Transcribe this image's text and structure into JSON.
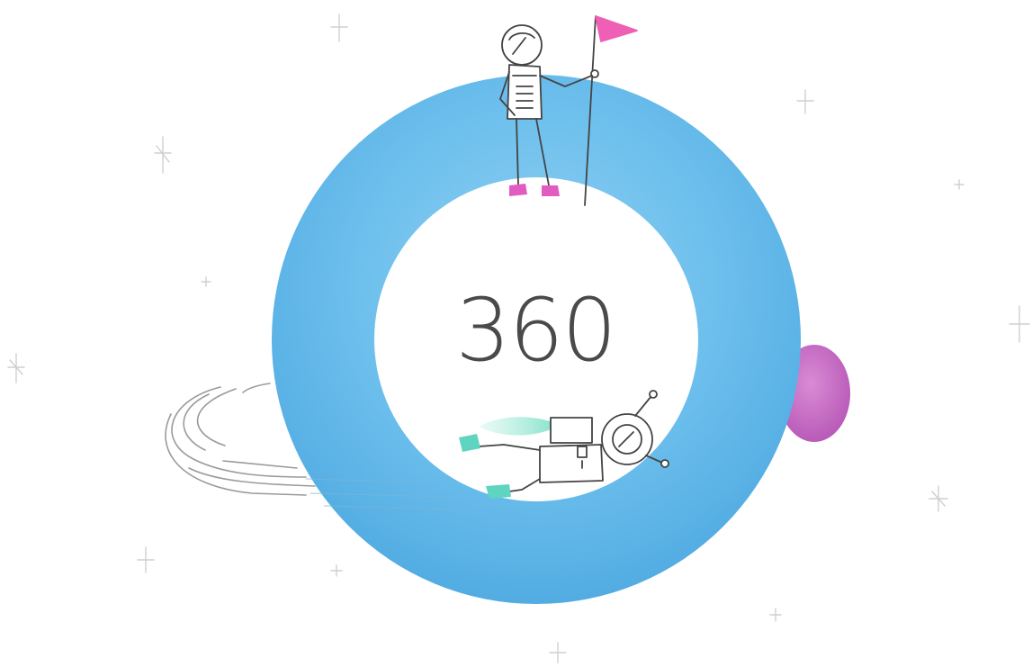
{
  "score": {
    "value": "360"
  },
  "colors": {
    "ring": "#5bb6e8",
    "ring_light": "#7cc6ef",
    "flag": "#ee5fb5",
    "boots": "#e25bc0",
    "planet": "#c96cc4",
    "jet_flame": "#7fe0c8",
    "line": "#555555",
    "star": "#cccccc"
  },
  "illustration": {
    "top_figure": "astronaut-with-flag",
    "bottom_figure": "flying-astronaut-with-jetpack",
    "side_object": "pink-planet"
  }
}
